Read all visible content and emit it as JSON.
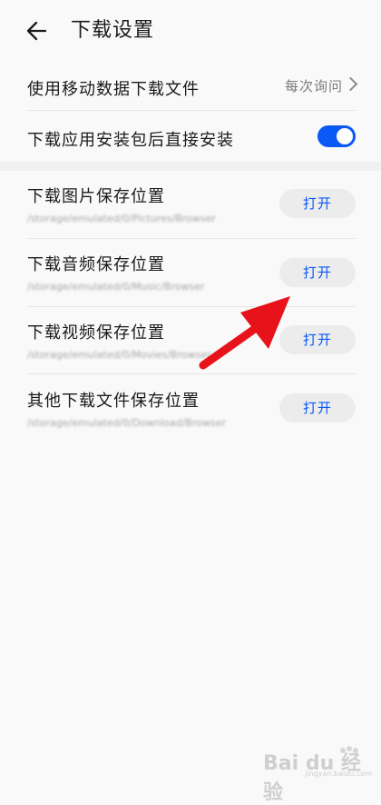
{
  "header": {
    "title": "下载设置"
  },
  "mobile_data": {
    "label": "使用移动数据下载文件",
    "value": "每次询问"
  },
  "auto_install": {
    "label": "下载应用安装包后直接安装",
    "enabled": true
  },
  "locations": [
    {
      "label": "下载图片保存位置",
      "path": "/storage/emulated/0/Pictures/Browser",
      "button": "打开"
    },
    {
      "label": "下载音频保存位置",
      "path": "/storage/emulated/0/Music/Browser",
      "button": "打开"
    },
    {
      "label": "下载视频保存位置",
      "path": "/storage/emulated/0/Movies/Browser",
      "button": "打开"
    },
    {
      "label": "其他下载文件保存位置",
      "path": "/storage/emulated/0/Download/Browser",
      "button": "打开"
    }
  ],
  "watermark": {
    "text": "Bai du 经验",
    "brand_text": "jingyan.baidu.com"
  },
  "colors": {
    "accent": "#0a59f7",
    "annotation_arrow": "#e8121b"
  }
}
